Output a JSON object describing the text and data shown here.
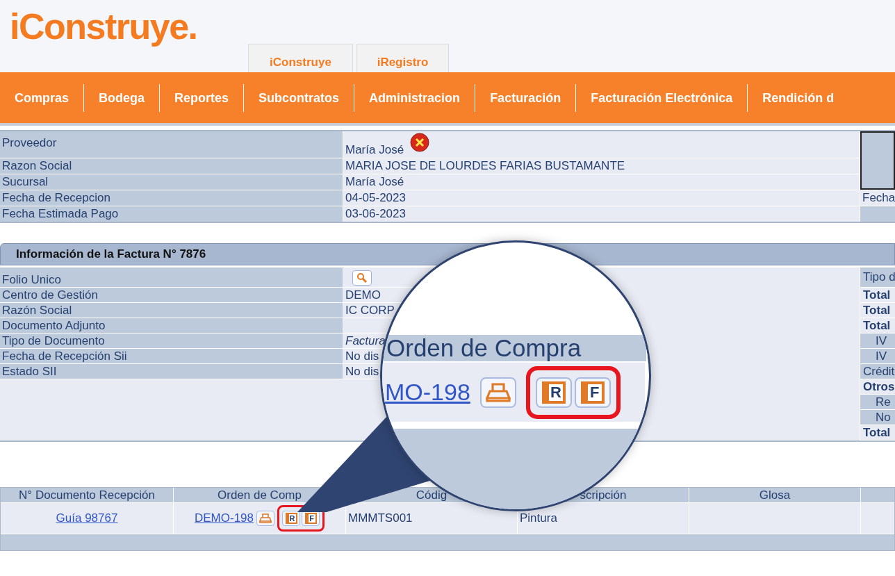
{
  "logo": "iConstruye.",
  "app_tabs": [
    {
      "label": "iConstruye"
    },
    {
      "label": "iRegistro"
    }
  ],
  "nav": [
    "Compras",
    "Bodega",
    "Reportes",
    "Subcontratos",
    "Administracion",
    "Facturación",
    "Facturación Electrónica",
    "Rendición d"
  ],
  "supplier": {
    "rows": [
      {
        "label": "Proveedor",
        "value": "María José",
        "kind": "removable"
      },
      {
        "label": "Razon Social",
        "value": "MARIA JOSE DE LOURDES FARIAS BUSTAMANTE",
        "kind": "plain"
      },
      {
        "label": "Sucursal",
        "value": "María José",
        "kind": "plain"
      },
      {
        "label": "Fecha de Recepcion",
        "value": "04-05-2023",
        "kind": "plain",
        "side": "Fecha"
      },
      {
        "label": "Fecha Estimada Pago",
        "value": "03-06-2023",
        "kind": "plain"
      }
    ]
  },
  "invoice": {
    "title": "Información de la Factura N° 7876",
    "rows": [
      {
        "label": "Folio Unico",
        "kind": "search"
      },
      {
        "label": "Centro de Gestión",
        "value": "DEMO",
        "kind": "plain"
      },
      {
        "label": "Razón Social",
        "value": "IC CORP",
        "kind": "plain"
      },
      {
        "label": "Documento Adjunto",
        "kind": "plain"
      },
      {
        "label": "Tipo de Documento",
        "value": "Factura",
        "kind": "italic"
      },
      {
        "label": "Fecha de Recepción Sii",
        "value": "No dis",
        "kind": "plain"
      },
      {
        "label": "Estado SII",
        "value": "No dis",
        "kind": "plain"
      }
    ],
    "side": [
      {
        "label": "Tipo d",
        "kind": "plain"
      },
      {
        "label": "Total",
        "kind": "total"
      },
      {
        "label": "Total",
        "kind": "total"
      },
      {
        "label": "Total",
        "kind": "total"
      },
      {
        "label": "IV",
        "kind": "sub"
      },
      {
        "label": "IV",
        "kind": "sub"
      },
      {
        "label": "Crédit",
        "kind": "plain"
      },
      {
        "label": "Otros",
        "kind": "total"
      },
      {
        "label": "Re",
        "kind": "sub"
      },
      {
        "label": "No",
        "kind": "sub"
      },
      {
        "label": "Total",
        "kind": "total"
      }
    ]
  },
  "receptions": {
    "columns": [
      "N° Documento Recepción",
      "Orden de Comp",
      "Códig",
      "scripción",
      "Glosa"
    ],
    "rows": [
      {
        "reception": "Guía 98767",
        "order": "DEMO-198",
        "report_icons": [
          "R",
          "F"
        ],
        "code": "MMMTS001",
        "description": "Pintura"
      }
    ]
  },
  "magnifier": {
    "header": "Orden de Compra",
    "link": "MO-198",
    "report_icons": [
      "R",
      "F"
    ]
  }
}
